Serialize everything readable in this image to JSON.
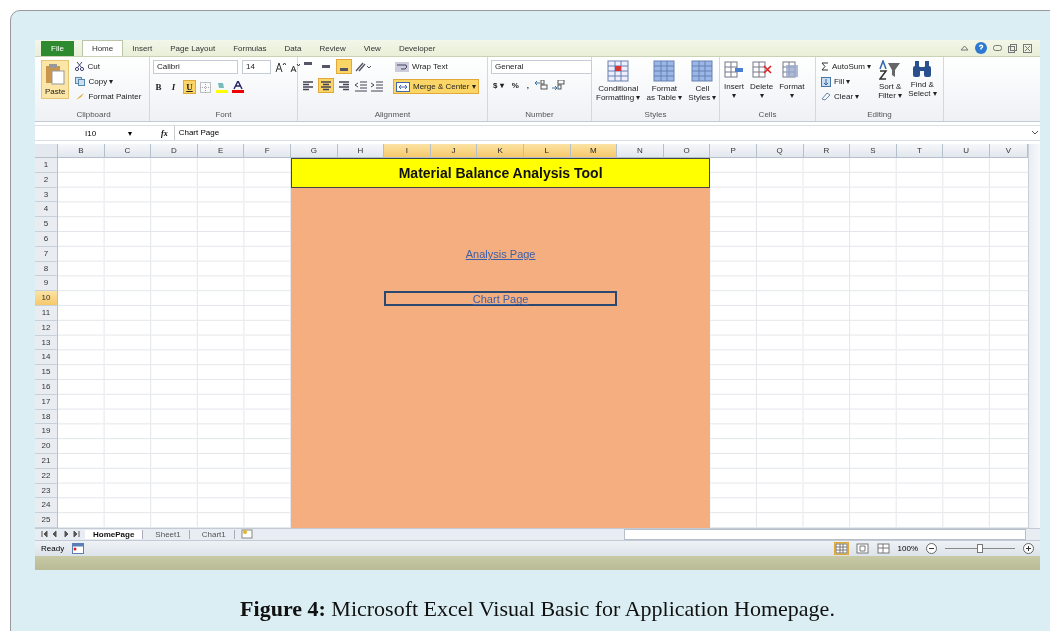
{
  "ribbon_tabs": [
    {
      "label": "File",
      "kind": "file"
    },
    {
      "label": "Home",
      "selected": true,
      "kind": "tab"
    },
    {
      "label": "Insert",
      "selected": false,
      "kind": "tab"
    },
    {
      "label": "Page Layout",
      "selected": false,
      "kind": "tab"
    },
    {
      "label": "Formulas",
      "selected": false,
      "kind": "tab"
    },
    {
      "label": "Data",
      "selected": false,
      "kind": "tab"
    },
    {
      "label": "Review",
      "selected": false,
      "kind": "tab"
    },
    {
      "label": "View",
      "selected": false,
      "kind": "tab"
    },
    {
      "label": "Developer",
      "selected": false,
      "kind": "tab"
    }
  ],
  "clipboard": {
    "label": "Clipboard",
    "paste": "Paste",
    "cut": "Cut",
    "copy": "Copy ▾",
    "format_painter": "Format Painter"
  },
  "font": {
    "label": "Font",
    "name": "Calibri",
    "size": "14",
    "styles": [
      {
        "label": "B",
        "selected": false
      },
      {
        "label": "I",
        "selected": false
      },
      {
        "label": "U",
        "selected": true
      }
    ]
  },
  "alignment": {
    "label": "Alignment",
    "vertical": [
      {
        "selected": false
      },
      {
        "selected": false
      },
      {
        "selected": true
      }
    ],
    "horizontal": [
      {
        "selected": false
      },
      {
        "selected": true
      },
      {
        "selected": false
      }
    ],
    "wrap_text": "Wrap Text",
    "merge_center": "Merge & Center",
    "merge_caret": "▾",
    "merge_selected": true
  },
  "number": {
    "label": "Number",
    "format": "General",
    "symbols": [
      "$ ▾",
      "%",
      ","
    ]
  },
  "styles": {
    "label": "Styles",
    "buttons": [
      {
        "line1": "Conditional",
        "line2": "Formatting ▾"
      },
      {
        "line1": "Format",
        "line2": "as Table ▾"
      },
      {
        "line1": "Cell",
        "line2": "Styles ▾"
      }
    ]
  },
  "cells": {
    "label": "Cells",
    "buttons": [
      {
        "label": "Insert",
        "caret": "▾"
      },
      {
        "label": "Delete",
        "caret": "▾"
      },
      {
        "label": "Format",
        "caret": "▾"
      }
    ]
  },
  "editing": {
    "label": "Editing",
    "autosum": "AutoSum ▾",
    "fill": "Fill ▾",
    "clear": "Clear ▾",
    "sort": {
      "line1": "Sort &",
      "line2": "Filter ▾"
    },
    "find": {
      "line1": "Find &",
      "line2": "Select ▾"
    }
  },
  "name_box": "I10",
  "name_box_caret": "▾",
  "fx": "fx",
  "formula": "Chart Page",
  "columns": [
    {
      "label": "B",
      "selected": false
    },
    {
      "label": "C",
      "selected": false
    },
    {
      "label": "D",
      "selected": false
    },
    {
      "label": "E",
      "selected": false
    },
    {
      "label": "F",
      "selected": false
    },
    {
      "label": "G",
      "selected": false
    },
    {
      "label": "H",
      "selected": false
    },
    {
      "label": "I",
      "selected": true
    },
    {
      "label": "J",
      "selected": true
    },
    {
      "label": "K",
      "selected": true
    },
    {
      "label": "L",
      "selected": true
    },
    {
      "label": "M",
      "selected": true
    },
    {
      "label": "N",
      "selected": false
    },
    {
      "label": "O",
      "selected": false
    },
    {
      "label": "P",
      "selected": false
    },
    {
      "label": "Q",
      "selected": false
    },
    {
      "label": "R",
      "selected": false
    },
    {
      "label": "S",
      "selected": false
    },
    {
      "label": "T",
      "selected": false
    },
    {
      "label": "U",
      "selected": false
    },
    {
      "label": "V",
      "selected": false
    }
  ],
  "rows": [
    {
      "label": "1",
      "selected": false
    },
    {
      "label": "2",
      "selected": false
    },
    {
      "label": "3",
      "selected": false
    },
    {
      "label": "4",
      "selected": false
    },
    {
      "label": "5",
      "selected": false
    },
    {
      "label": "6",
      "selected": false
    },
    {
      "label": "7",
      "selected": false
    },
    {
      "label": "8",
      "selected": false
    },
    {
      "label": "9",
      "selected": false
    },
    {
      "label": "10",
      "selected": true
    },
    {
      "label": "11",
      "selected": false
    },
    {
      "label": "12",
      "selected": false
    },
    {
      "label": "13",
      "selected": false
    },
    {
      "label": "14",
      "selected": false
    },
    {
      "label": "15",
      "selected": false
    },
    {
      "label": "16",
      "selected": false
    },
    {
      "label": "17",
      "selected": false
    },
    {
      "label": "18",
      "selected": false
    },
    {
      "label": "19",
      "selected": false
    },
    {
      "label": "20",
      "selected": false
    },
    {
      "label": "21",
      "selected": false
    },
    {
      "label": "22",
      "selected": false
    },
    {
      "label": "23",
      "selected": false
    },
    {
      "label": "24",
      "selected": false
    },
    {
      "label": "25",
      "selected": false
    }
  ],
  "sheet": {
    "title": "Material Balance Analysis Tool",
    "links": [
      {
        "label": "Analysis Page",
        "selected": false
      },
      {
        "label": "Chart Page",
        "selected": true
      }
    ]
  },
  "sheet_tabs": [
    {
      "label": "HomePage",
      "selected": true
    },
    {
      "label": "Sheet1",
      "selected": false
    },
    {
      "label": "Chart1",
      "selected": false
    }
  ],
  "status": {
    "text": "Ready",
    "views": [
      {
        "selected": true
      },
      {
        "selected": false
      },
      {
        "selected": false
      }
    ],
    "zoom": "100%",
    "level": 0.5
  },
  "caption": "**Figure 4:** Microsoft Excel Visual Basic for Application Homepage."
}
